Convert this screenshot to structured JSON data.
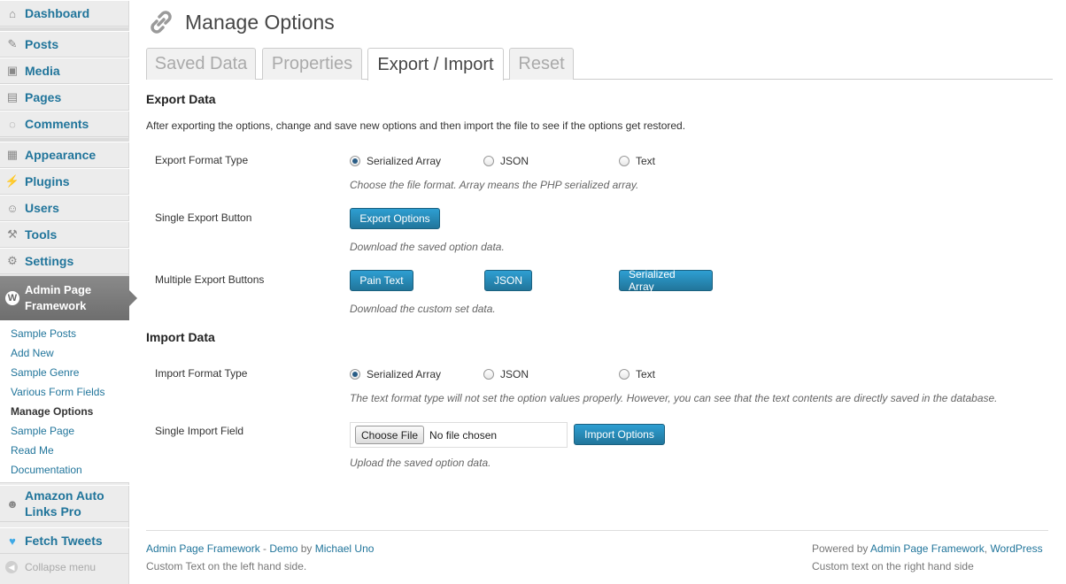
{
  "sidebar": {
    "dashboard": "Dashboard",
    "posts": "Posts",
    "media": "Media",
    "pages": "Pages",
    "comments": "Comments",
    "appearance": "Appearance",
    "plugins": "Plugins",
    "users": "Users",
    "tools": "Tools",
    "settings": "Settings",
    "apf_line1": "Admin Page",
    "apf_line2": "Framework",
    "submenu": [
      "Sample Posts",
      "Add New",
      "Sample Genre",
      "Various Form Fields",
      "Manage Options",
      "Sample Page",
      "Read Me",
      "Documentation"
    ],
    "amazon_line1": "Amazon Auto",
    "amazon_line2": "Links Pro",
    "fetch_tweets": "Fetch Tweets",
    "collapse": "Collapse menu"
  },
  "page": {
    "title": "Manage Options",
    "tabs": [
      "Saved Data",
      "Properties",
      "Export / Import",
      "Reset"
    ],
    "active_tab": "Export / Import"
  },
  "export": {
    "title": "Export Data",
    "description": "After exporting the options, change and save new options and then import the file to see if the options get restored.",
    "format_label": "Export Format Type",
    "format_options": [
      "Serialized Array",
      "JSON",
      "Text"
    ],
    "format_selected": "Serialized Array",
    "format_hint": "Choose the file format. Array means the PHP serialized array.",
    "single_label": "Single Export Button",
    "single_button": "Export Options",
    "single_hint": "Download the saved option data.",
    "multi_label": "Multiple Export Buttons",
    "multi_buttons": [
      "Pain Text",
      "JSON",
      "Serialized Array"
    ],
    "multi_hint": "Download the custom set data."
  },
  "import": {
    "title": "Import Data",
    "format_label": "Import Format Type",
    "format_options": [
      "Serialized Array",
      "JSON",
      "Text"
    ],
    "format_selected": "Serialized Array",
    "format_hint": "The text format type will not set the option values properly. However, you can see that the text contents are directly saved in the database.",
    "field_label": "Single Import Field",
    "choose_file": "Choose File",
    "no_file": "No file chosen",
    "import_button": "Import Options",
    "field_hint": "Upload the saved option data."
  },
  "footer": {
    "left_link1": "Admin Page Framework",
    "left_sep": " - ",
    "left_link2": "Demo",
    "left_by": " by ",
    "left_author": "Michael Uno",
    "left_custom": "Custom Text on the left hand side.",
    "right_powered": "Powered by ",
    "right_link1": "Admin Page Framework",
    "right_comma": ", ",
    "right_link2": "WordPress",
    "right_custom": "Custom text on the right hand side"
  },
  "colors": {
    "link": "#21759b",
    "button": "#21759b",
    "sidebar_bg": "#ececec",
    "active_menu": "#777777"
  }
}
